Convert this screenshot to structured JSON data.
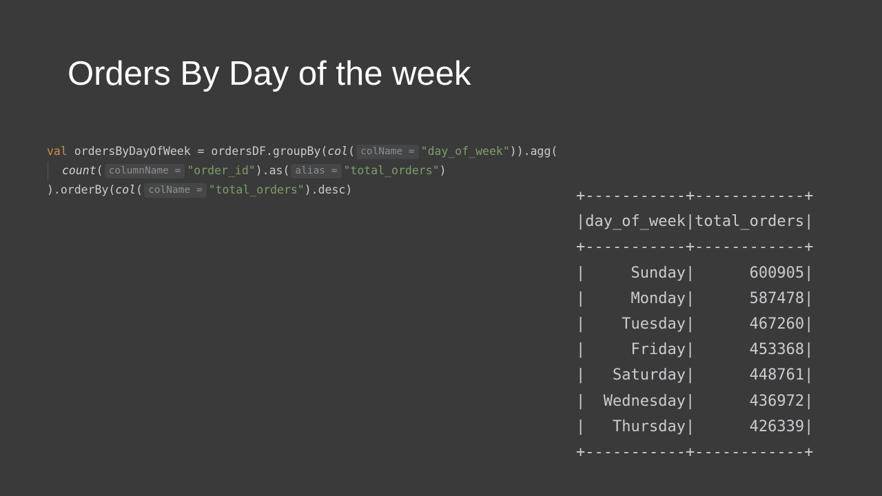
{
  "slide": {
    "title": "Orders By Day of the week"
  },
  "code": {
    "line1": {
      "keyword": "val",
      "text_a": " ordersByDayOfWeek = ordersDF.groupBy(",
      "fn_col": "col",
      "paren_open": "(",
      "hint_colName": "colName =",
      "string_day": "\"day_of_week\"",
      "text_b": ")).agg("
    },
    "line2": {
      "fn_count": "count",
      "paren_open": "(",
      "hint_columnName": "columnName =",
      "string_order_id": "\"order_id\"",
      "text_as": ").as(",
      "hint_alias": "alias =",
      "string_total": "\"total_orders\"",
      "paren_close": ")"
    },
    "line3": {
      "text_a": ").orderBy(",
      "fn_col": "col",
      "paren_open": "(",
      "hint_colName": "colName =",
      "string_total": "\"total_orders\"",
      "text_b": ").desc)"
    }
  },
  "table": {
    "border_top": "+-----------+------------+",
    "header": "|day_of_week|total_orders|",
    "border_mid": "+-----------+------------+",
    "rows": [
      "|     Sunday|      600905|",
      "|     Monday|      587478|",
      "|    Tuesday|      467260|",
      "|     Friday|      453368|",
      "|   Saturday|      448761|",
      "|  Wednesday|      436972|",
      "|   Thursday|      426339|"
    ],
    "border_bottom": "+-----------+------------+"
  },
  "colors": {
    "background": "#3a3a3a",
    "keyword": "#cc8a52",
    "string": "#7d9f6a",
    "text": "#c9ccd1",
    "hint_bg": "#444648",
    "hint_text": "#8b8e91"
  }
}
